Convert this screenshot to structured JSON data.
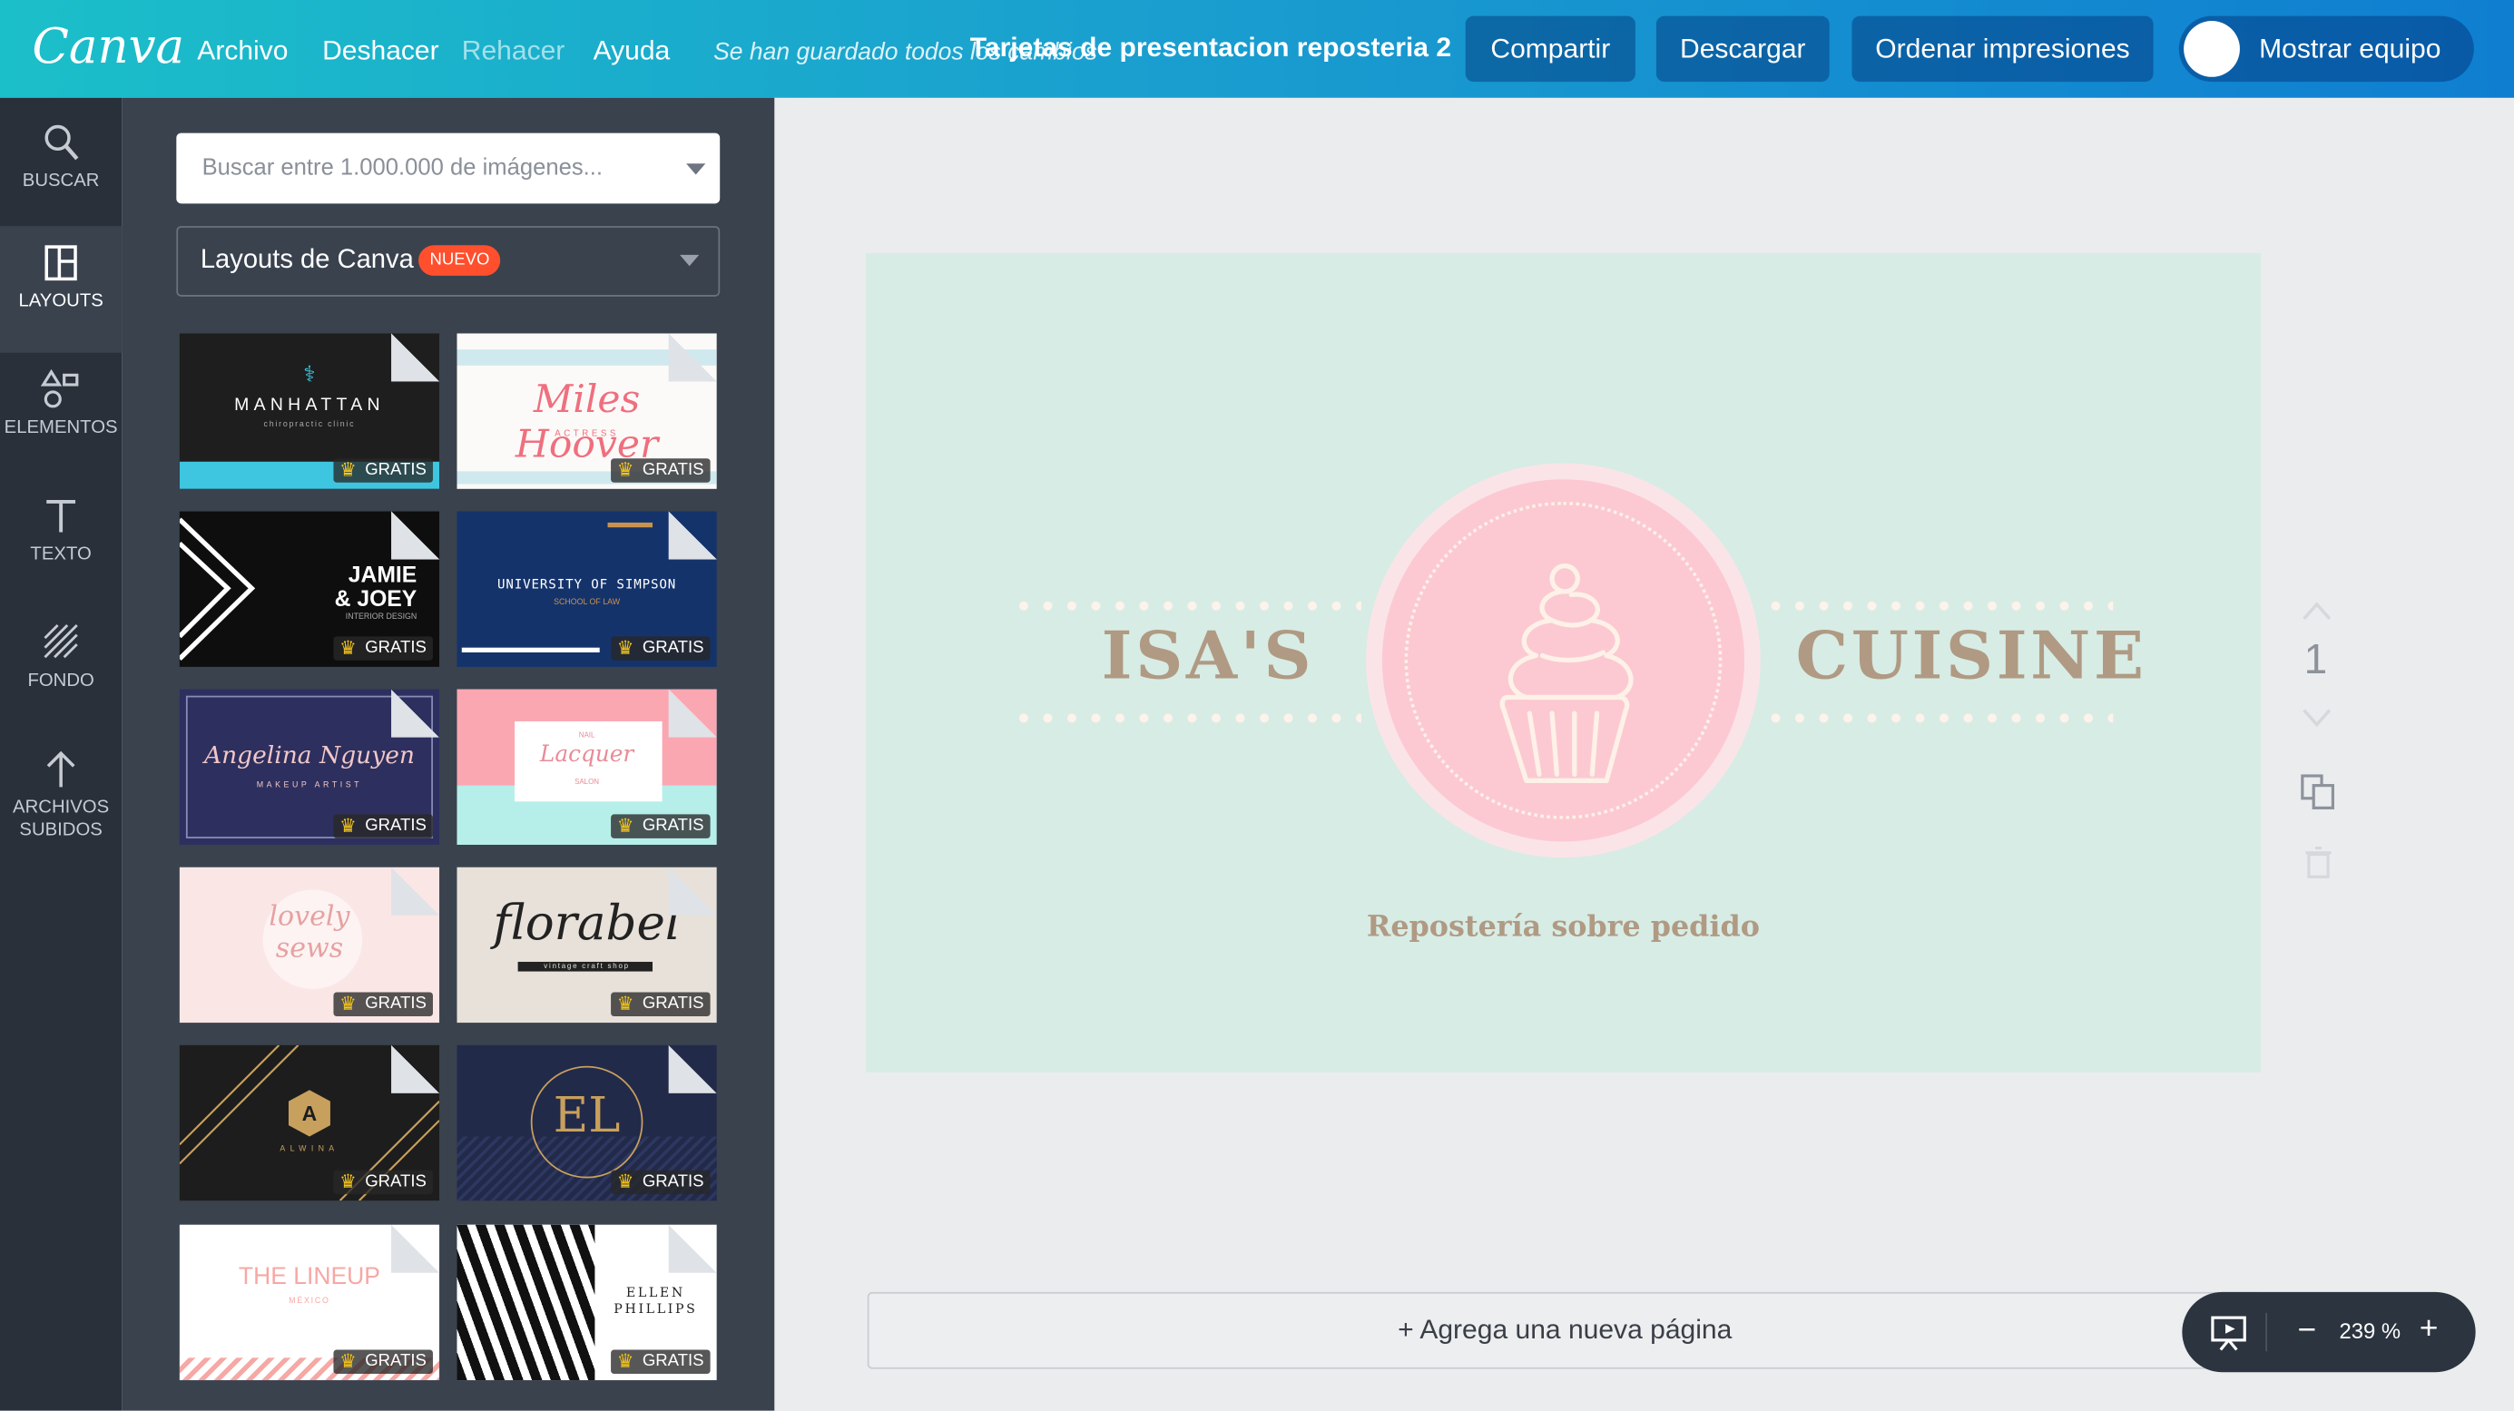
{
  "app": {
    "logo": "Canva",
    "title": "Tarjetas de presentacion reposteria 2",
    "saved_status": "Se han guardado todos los cambios"
  },
  "menu": {
    "archivo": "Archivo",
    "deshacer": "Deshacer",
    "rehacer": "Rehacer",
    "ayuda": "Ayuda"
  },
  "toolbar": {
    "compartir": "Compartir",
    "descargar": "Descargar",
    "ordenar": "Ordenar impresiones",
    "equipo": "Mostrar equipo"
  },
  "nav": {
    "buscar": "BUSCAR",
    "layouts": "LAYOUTS",
    "elementos": "ELEMENTOS",
    "texto": "TEXTO",
    "fondo": "FONDO",
    "archivos_1": "ARCHIVOS",
    "archivos_2": "SUBIDOS"
  },
  "panel": {
    "search_placeholder": "Buscar entre 1.000.000 de imágenes...",
    "layouts_select": "Layouts de Canva",
    "new_badge": "NUEVO",
    "free_label": "GRATIS",
    "cards": {
      "c1": "MANHATTAN",
      "c1_sub": "chiropractic clinic",
      "c2": "Miles Hoover",
      "c2_sub": "ACTRESS",
      "c3_1": "JAMIE",
      "c3_2": "& JOEY",
      "c3_sub": "INTERIOR DESIGN",
      "c4": "UNIVERSITY OF SIMPSON",
      "c4_sub": "SCHOOL OF LAW",
      "c5": "Angelina Nguyen",
      "c5_sub": "MAKEUP ARTIST",
      "c6_top": "NAIL",
      "c6": "Lacquer",
      "c6_sub": "SALON",
      "c7_1": "lovely",
      "c7_2": "sews",
      "c8": "florabel",
      "c8_sub": "vintage craft shop",
      "c9": "A",
      "c9_sub": "ALWINA",
      "c10": "EL",
      "c11": "THE LINEUP",
      "c11_sub": "MÉXICO",
      "c12_1": "ELLEN",
      "c12_2": "PHILLIPS"
    }
  },
  "design": {
    "name_left": "ISA'S",
    "name_right": "CUISINE",
    "subtitle": "Repostería sobre pedido"
  },
  "canvas": {
    "page_number": "1",
    "add_page": "+ Agrega una nueva página",
    "zoom": "239 %"
  },
  "colors": {
    "mint": "#d7ece5",
    "pink": "#fcc9d2",
    "gold": "#b09a83",
    "cream": "#fdf3ea"
  }
}
